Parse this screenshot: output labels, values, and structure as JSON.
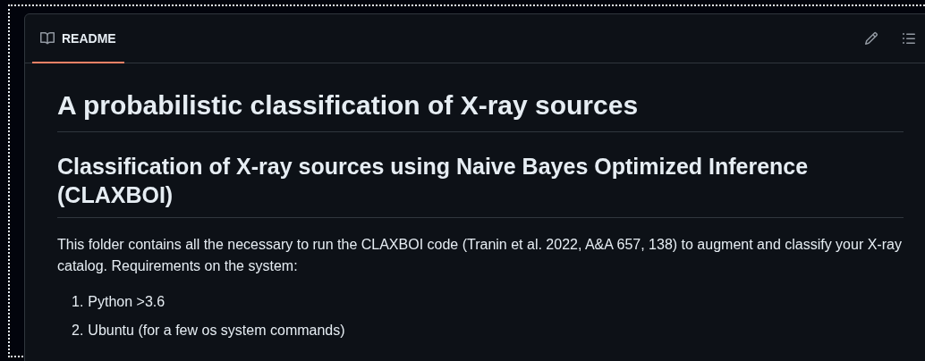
{
  "tab": {
    "label": "README",
    "selected": true
  },
  "title": "A probabilistic classification of X-ray sources",
  "subtitle": "Classification of X-ray sources using Naive Bayes Optimized Inference (CLAXBOI)",
  "paragraph": "This folder contains all the necessary to run the CLAXBOI code (Tranin et al. 2022, A&A 657, 138) to augment and classify your X-ray catalog. Requirements on the system:",
  "requirements": [
    {
      "number": "1.",
      "text": "Python >3.6"
    },
    {
      "number": "2.",
      "text": "Ubuntu (for a few os system commands)"
    }
  ]
}
